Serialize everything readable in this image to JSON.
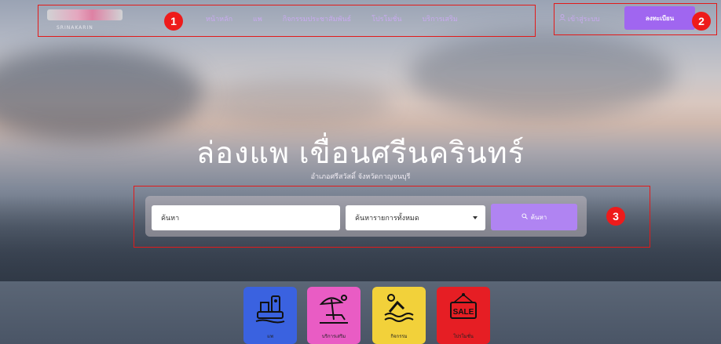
{
  "brand": {
    "logo_sub": "SRINAKARIN"
  },
  "nav": {
    "links": [
      "หน้าหลัก",
      "แพ",
      "กิจกรรมประชาสัมพันธ์",
      "โปรโมชั่น",
      "บริการเสริม"
    ],
    "login": "เข้าสู่ระบบ",
    "register": "ลงทะเบียน"
  },
  "hero": {
    "title": "ล่องแพ เขื่อนศรีนครินทร์",
    "subtitle": "อำเภอศรีสวัสดิ์ จังหวัดกาญจนบุรี"
  },
  "search": {
    "input_value": "ค้นหา",
    "select_value": "ค้นหารายการทั้งหมด",
    "button_label": "ค้นหา"
  },
  "annotations": {
    "badge1": "1",
    "badge2": "2",
    "badge3": "3"
  },
  "categories": [
    {
      "label": "แพ",
      "icon": "raft-icon",
      "color": "#3a62e0"
    },
    {
      "label": "บริการเสริม",
      "icon": "beach-umbrella-icon",
      "color": "#e95cc4"
    },
    {
      "label": "กิจกรรม",
      "icon": "swimmer-icon",
      "color": "#f2d13a"
    },
    {
      "label": "โปรโมชั่น",
      "icon": "sale-sign-icon",
      "color": "#e61e24"
    }
  ],
  "colors": {
    "accent": "#a066f0",
    "annotation": "#e21a1a"
  }
}
